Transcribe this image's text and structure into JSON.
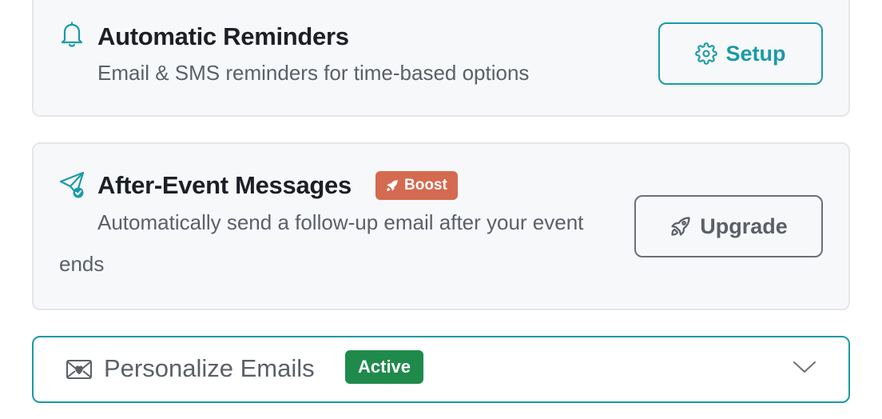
{
  "reminders": {
    "title": "Automatic Reminders",
    "subtitle": "Email & SMS reminders for time-based options",
    "icon": "bell-icon",
    "button_label": "Setup",
    "button_icon": "gear-icon"
  },
  "after_event": {
    "title": "After-Event Messages",
    "badge": "Boost",
    "badge_icon": "rocket-icon",
    "description": "Automatically send a follow-up email after your event ends",
    "icon": "paper-plane-check-icon",
    "button_label": "Upgrade",
    "button_icon": "rocket-icon"
  },
  "personalize": {
    "title": "Personalize Emails",
    "badge": "Active",
    "icon": "envelope-heart-icon",
    "toggle_icon": "chevron-down-icon"
  },
  "colors": {
    "accent": "#1b9aa8",
    "boost": "#d46a50",
    "active": "#1f8a4c",
    "text": "#1c1f24",
    "muted": "#5b6068",
    "card_bg": "#f7f8fa",
    "card_border": "#e4e6ea"
  }
}
